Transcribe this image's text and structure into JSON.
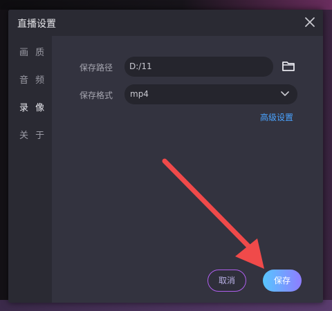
{
  "dialog": {
    "title": "直播设置",
    "close_icon": "close-icon"
  },
  "sidebar": {
    "items": [
      {
        "label": "画 质",
        "active": false
      },
      {
        "label": "音 频",
        "active": false
      },
      {
        "label": "录 像",
        "active": true
      },
      {
        "label": "关 于",
        "active": false
      }
    ]
  },
  "form": {
    "path_label": "保存路径",
    "path_value": "D:/11",
    "folder_icon": "folder-icon",
    "format_label": "保存格式",
    "format_value": "mp4",
    "chevron_icon": "chevron-down-icon",
    "advanced_label": "高级设置"
  },
  "footer": {
    "cancel_label": "取消",
    "save_label": "保存"
  },
  "colors": {
    "accent_link": "#4aa3ff",
    "save_gradient_start": "#57c6ff",
    "save_gradient_end": "#8e7dff",
    "cancel_border": "#b05ff0",
    "annotation_arrow": "#f04a4a"
  }
}
